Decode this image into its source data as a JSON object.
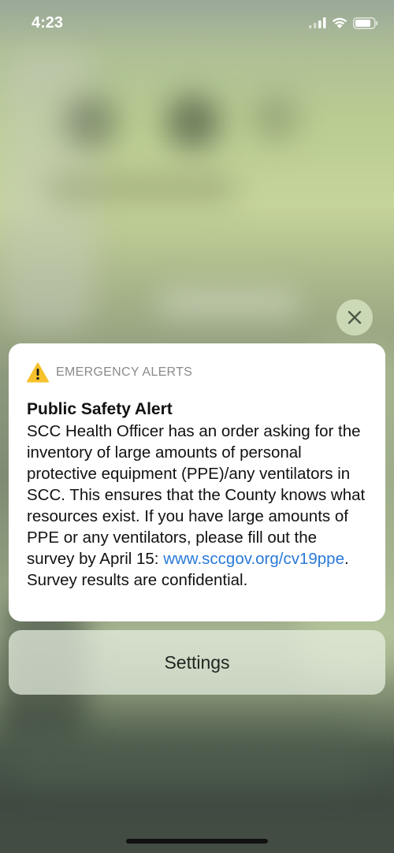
{
  "status_bar": {
    "time": "4:23"
  },
  "alert": {
    "app_name": "EMERGENCY ALERTS",
    "title": "Public Safety Alert",
    "body_before_link": "SCC Health Officer has an order asking for the inventory of large amounts of personal protective equipment (PPE)/any ventilators in SCC. This ensures that the County knows what resources exist. If you have large amounts of PPE or any ventilators, please fill out the survey by April 15:",
    "link_text": "www.sccgov.org/cv19ppe",
    "body_after_link": ". Survey results are confidential."
  },
  "settings_label": "Settings",
  "icons": {
    "warning": "warning-triangle-icon",
    "close": "close-icon",
    "signal": "cellular-signal-icon",
    "wifi": "wifi-icon",
    "battery": "battery-icon"
  },
  "colors": {
    "warning": "#f6c12a",
    "link": "#2a7ad8"
  }
}
